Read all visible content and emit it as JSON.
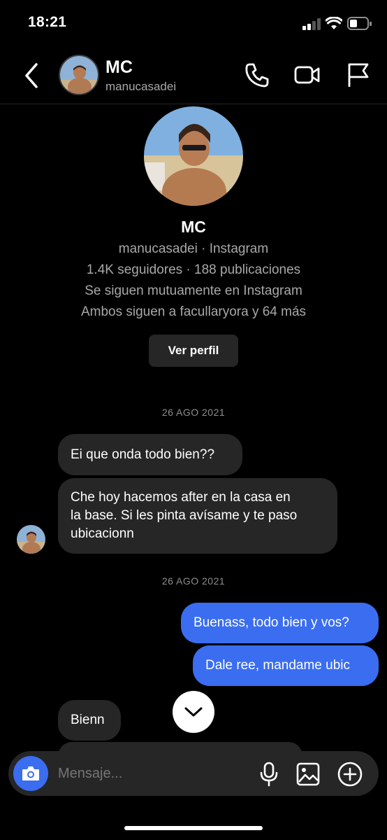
{
  "status_bar": {
    "time": "18:21"
  },
  "header": {
    "name": "MC",
    "username": "manucasadei"
  },
  "profile": {
    "name": "MC",
    "line1": "manucasadei · Instagram",
    "line2": "1.4K seguidores · 188 publicaciones",
    "line3": "Se siguen mutuamente en Instagram",
    "line4": "Ambos siguen a facullaryora y 64 más",
    "button": "Ver perfil"
  },
  "thread": {
    "date1": "26 AGO 2021",
    "in1": "Ei que onda todo bien??",
    "in2_line1": "Che hoy hacemos after en la casa en",
    "in2_line2": "la base. Si les pinta avísame y te paso",
    "in2_line3": "ubicacionn",
    "date2": "26 AGO 2021",
    "out1": "Buenass, todo bien y vos?",
    "out2": "Dale ree, mandame ubic",
    "in3": "Bienn"
  },
  "composer": {
    "placeholder": "Mensaje..."
  },
  "colors": {
    "accent": "#3a6df0",
    "bubble_in": "#262626",
    "background": "#000000"
  }
}
